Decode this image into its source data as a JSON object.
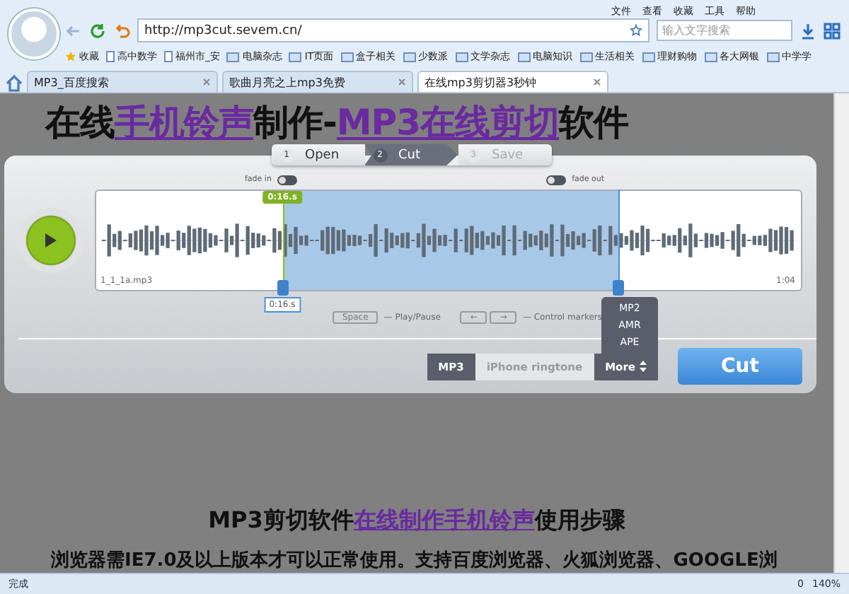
{
  "browser": {
    "menu": [
      "文件",
      "查看",
      "收藏",
      "工具",
      "帮助"
    ],
    "address": "http://mp3cut.sevem.cn/",
    "search": {
      "placeholder": "输入文字搜索"
    },
    "bookmarks": [
      {
        "label": "收藏",
        "kind": "star"
      },
      {
        "label": "高中数学",
        "kind": "page"
      },
      {
        "label": "福州市_安",
        "kind": "page"
      },
      {
        "label": "电脑杂志",
        "kind": "folder"
      },
      {
        "label": "IT页面",
        "kind": "folder"
      },
      {
        "label": "盒子相关",
        "kind": "folder"
      },
      {
        "label": "少数派",
        "kind": "folder"
      },
      {
        "label": "文学杂志",
        "kind": "folder"
      },
      {
        "label": "电脑知识",
        "kind": "folder"
      },
      {
        "label": "生活相关",
        "kind": "folder"
      },
      {
        "label": "理财购物",
        "kind": "folder"
      },
      {
        "label": "各大网银",
        "kind": "folder"
      },
      {
        "label": "中学学",
        "kind": "folder"
      }
    ],
    "tabs": [
      {
        "label": "MP3_百度搜索",
        "selected": false
      },
      {
        "label": "歌曲月亮之上mp3免费",
        "selected": false
      },
      {
        "label": "在线mp3剪切器3秒钟",
        "selected": true
      }
    ]
  },
  "page": {
    "title": [
      {
        "text": "在线",
        "highlight": false
      },
      {
        "text": "手机铃声",
        "highlight": true
      },
      {
        "text": "制作-",
        "highlight": false
      },
      {
        "text": "MP3在线剪切",
        "highlight": true
      },
      {
        "text": "软件",
        "highlight": false
      }
    ],
    "steps": [
      {
        "number": "1",
        "label": "Open",
        "selected": false,
        "disabled": false
      },
      {
        "number": "2",
        "label": "Cut",
        "selected": true,
        "disabled": false
      },
      {
        "number": "3",
        "label": "Save",
        "selected": false,
        "disabled": true
      }
    ],
    "fade_in": {
      "label": "fade in",
      "on": false
    },
    "fade_out": {
      "label": "fade out",
      "on": false
    },
    "waveform": {
      "filename": "1_1_1a.mp3",
      "duration": "1:04"
    },
    "markers": [
      {
        "level": 0.265,
        "top_label": "0:16.s",
        "bottom_label": "0:16.s"
      },
      {
        "level": 0.74
      }
    ],
    "hints": [
      {
        "keys": [
          "Space"
        ],
        "text": "— Play/Pause"
      },
      {
        "keys": [
          "←",
          "→"
        ],
        "text": "— Control markers"
      }
    ],
    "formats": [
      {
        "label": "MP3",
        "selected": true
      },
      {
        "label": "iPhone ringtone",
        "selected": false
      },
      {
        "label": "More",
        "selected": false
      }
    ],
    "more_menu": [
      "MP2",
      "AMR",
      "APE"
    ],
    "cut_button": "Cut",
    "section_title": [
      {
        "text": "MP3剪切软件",
        "highlight": false
      },
      {
        "text": "在线制作手机铃声",
        "highlight": true
      },
      {
        "text": "使用步骤",
        "highlight": false
      }
    ],
    "paragraph": "浏览器需IE7.0及以上版本才可以正常使用。支持百度浏览器、火狐浏览器、GOOGLE浏"
  },
  "status_bar": {
    "text": "完成",
    "count": "0",
    "zoom": "140%"
  }
}
